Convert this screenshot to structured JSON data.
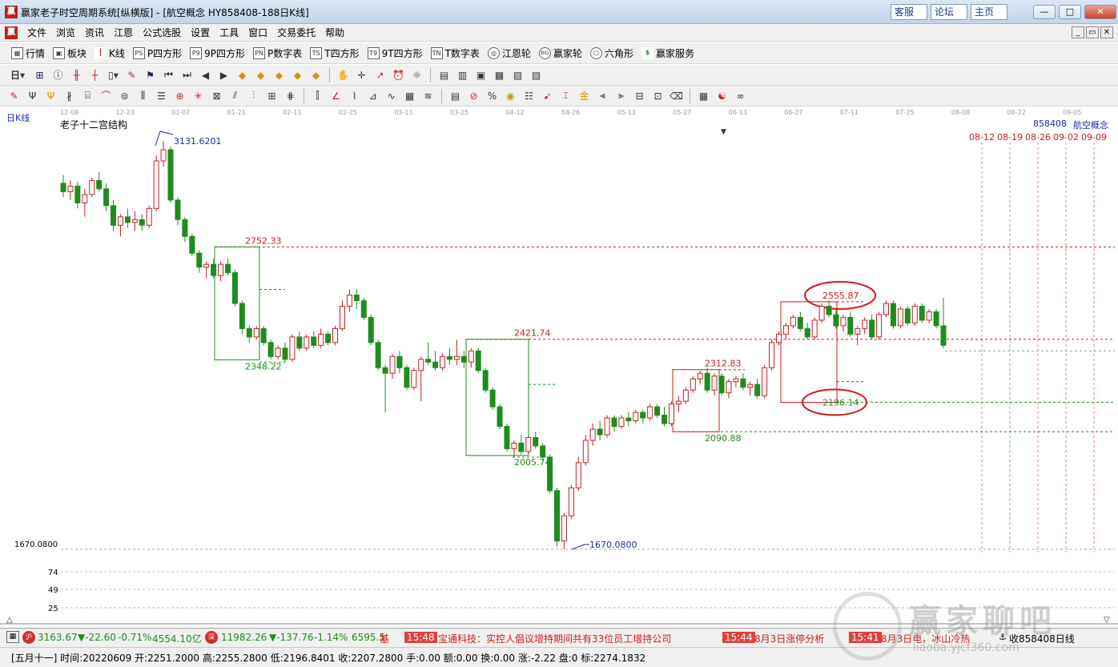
{
  "window": {
    "title": "赢家老子时空周期系统[纵横版] - [航空概念  HY858408-188日K线]",
    "links": [
      "客服",
      "论坛",
      "主页"
    ],
    "buttons": [
      "—",
      "□",
      "✕"
    ]
  },
  "menubar": {
    "items": [
      "文件",
      "浏览",
      "资讯",
      "江恩",
      "公式选股",
      "设置",
      "工具",
      "窗口",
      "交易委托",
      "帮助"
    ],
    "mdi": [
      "_",
      "▭",
      "✕"
    ]
  },
  "toolbar1": {
    "items": [
      {
        "label": "行情",
        "icon": "grid-icon"
      },
      {
        "label": "板块",
        "icon": "blocks-icon"
      },
      {
        "label": "K线",
        "icon": "candles-icon"
      },
      {
        "label": "P四方形",
        "icon": "PS"
      },
      {
        "label": "9P四方形",
        "icon": "P9"
      },
      {
        "label": "P数字表",
        "icon": "PN"
      },
      {
        "label": "T四方形",
        "icon": "TS"
      },
      {
        "label": "9T四方形",
        "icon": "T9"
      },
      {
        "label": "T数字表",
        "icon": "TN"
      },
      {
        "label": "江恩轮",
        "icon": "wheel-icon"
      },
      {
        "label": "赢家轮",
        "icon": "BIG"
      },
      {
        "label": "六角形",
        "icon": "hexagon-icon"
      },
      {
        "label": "赢家服务",
        "icon": "dollar-icon"
      }
    ]
  },
  "toolbar2": {
    "period_label": "日"
  },
  "chart": {
    "period_tag": "日K线",
    "indicator_name": "老子十二宫结构",
    "code": "858408",
    "name": "航空概念",
    "future_dates": [
      "08-12",
      "08-19",
      "08-26",
      "09-02",
      "09-09"
    ],
    "x_ticks": [
      "12-09",
      "12-23",
      "01-07",
      "01-21",
      "02-11",
      "02-25",
      "03-11",
      "03-25",
      "04-12",
      "04-26",
      "05-13",
      "05-27",
      "06-13",
      "06-27",
      "07-11",
      "07-25",
      "08-08",
      "08-22",
      "09-05"
    ],
    "price_annotations": {
      "high": "3131.6201",
      "low": "1670.0800",
      "low_axis": "1670.0800",
      "box1_top": "2752.33",
      "box1_bottom": "2348.22",
      "box2_top": "2421.74",
      "box2_bottom": "2005.74",
      "box3_top": "2312.83",
      "box3_bottom": "2090.88",
      "box4_top": "2555.87",
      "box4_bottom": "2196.14"
    },
    "lower_axis": [
      "74",
      "49",
      "25"
    ]
  },
  "chart_data": {
    "type": "candlestick",
    "title": "老子十二宫结构",
    "series_name": "航空概念",
    "ylim": [
      1670.08,
      3131.62
    ],
    "levels": [
      3131.6201,
      2752.33,
      2555.87,
      2421.74,
      2348.22,
      2312.83,
      2196.14,
      2090.88,
      2005.74,
      1670.08
    ],
    "x_ticks": [
      "12-09",
      "12-23",
      "01-07",
      "01-21",
      "02-11",
      "02-25",
      "03-11",
      "03-25",
      "04-12",
      "04-26",
      "05-13",
      "05-27",
      "06-13",
      "06-27",
      "07-11",
      "07-25",
      "08-08",
      "08-22",
      "09-05"
    ],
    "last_bar": {
      "date": "20220609",
      "open": 2251.2,
      "high": 2255.28,
      "low": 2196.8401,
      "close": 2207.28
    }
  },
  "status1": {
    "idx1_value": "3163.67",
    "idx1_change": "▼-22.60",
    "idx1_pct": "-0.71%",
    "idx1_amount": "4554.10亿",
    "idx2_value": "11982.26",
    "idx2_change": "▼-137.76",
    "idx2_pct": "-1.14%",
    "idx2_amount": "6595.5",
    "news": [
      {
        "time": "15:48",
        "text": "宝通科技：实控人倡议增持期间共有33位员工增持公司"
      },
      {
        "time": "15:44",
        "text": "8月3日涨停分析"
      },
      {
        "time": "15:41",
        "text": "8月3日电，冰山冷热"
      }
    ],
    "receiver": "收858408日线"
  },
  "status2": {
    "text": "[五月十一] 时间:20220609 开:2251.2000 高:2255.2800 低:2196.8401 收:2207.2800 手:0.00 额:0.00 换:0.00 涨:-2.22 盘:0 标:2274.1832"
  },
  "watermark": {
    "big": "赢家聊吧",
    "small": "liaoba.yjcf360.com"
  },
  "colors": {
    "up": "#c81e1e",
    "down": "#1e8c1e",
    "blue_label": "#1a2aa8"
  }
}
